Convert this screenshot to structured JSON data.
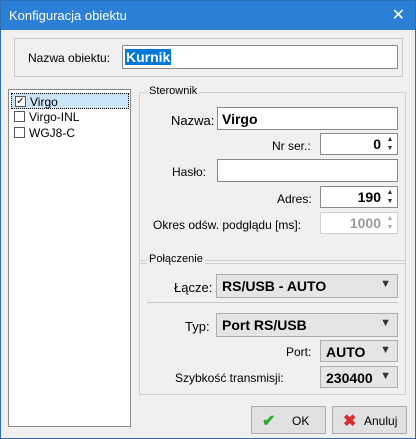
{
  "window": {
    "title": "Konfiguracja obiektu",
    "close_symbol": "✕"
  },
  "object_name": {
    "label": "Nazwa obiektu:",
    "value": "Kurnik"
  },
  "list": {
    "items": [
      {
        "label": "Virgo",
        "checked": true,
        "selected": true
      },
      {
        "label": "Virgo-INL",
        "checked": false,
        "selected": false
      },
      {
        "label": "WGJ8-C",
        "checked": false,
        "selected": false
      }
    ]
  },
  "controller": {
    "legend": "Sterownik",
    "name_label": "Nazwa:",
    "name_value": "Virgo",
    "serial_label": "Nr ser.:",
    "serial_value": "0",
    "password_label": "Hasło:",
    "password_value": "",
    "address_label": "Adres:",
    "address_value": "190",
    "refresh_label": "Okres odśw. podglądu [ms]:",
    "refresh_value": "1000"
  },
  "connection": {
    "legend": "Połączenie",
    "link_label": "Łącze:",
    "link_value": "RS/USB - AUTO",
    "type_label": "Typ:",
    "type_value": "Port RS/USB",
    "port_label": "Port:",
    "port_value": "AUTO",
    "speed_label": "Szybkość transmisji:",
    "speed_value": "230400"
  },
  "buttons": {
    "ok_label": "OK",
    "cancel_label": "Anuluj"
  },
  "colors": {
    "titlebar": "#2b7fd6",
    "ok_icon": "#2eab2e",
    "cancel_icon": "#d32f2f",
    "selection": "#0078d7"
  }
}
